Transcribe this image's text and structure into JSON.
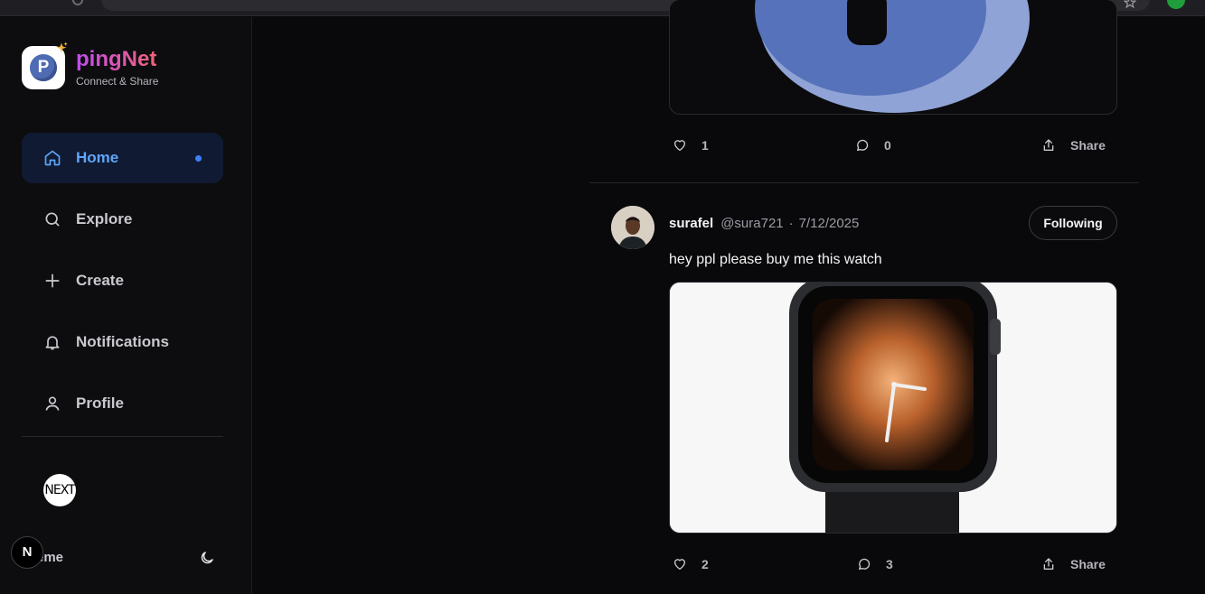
{
  "brand": {
    "name": "pingNet",
    "tagline": "Connect & Share"
  },
  "nav": {
    "items": [
      {
        "label": "Home",
        "active": true
      },
      {
        "label": "Explore"
      },
      {
        "label": "Create"
      },
      {
        "label": "Notifications"
      },
      {
        "label": "Profile"
      }
    ]
  },
  "sidebar_footer": {
    "avatar_text": "NEXT",
    "theme_label": "eme",
    "next_badge": "N"
  },
  "posts": [
    {
      "likes": "1",
      "comments": "0",
      "share_label": "Share"
    },
    {
      "author": "surafel",
      "handle": "@sura721",
      "separator": "·",
      "date": "7/12/2025",
      "follow_label": "Following",
      "text": "hey ppl please buy me this watch",
      "likes": "2",
      "comments": "3",
      "share_label": "Share"
    }
  ],
  "colors": {
    "accent": "#3b82f6",
    "active_bg": "#101b33",
    "background": "#09090b",
    "brand_gradient": [
      "#c14cf0",
      "#f06277"
    ]
  },
  "icons": [
    "home-icon",
    "search-icon",
    "plus-icon",
    "bell-icon",
    "user-icon",
    "moon-icon",
    "heart-icon",
    "comment-icon",
    "share-icon",
    "sparkle-icon"
  ]
}
